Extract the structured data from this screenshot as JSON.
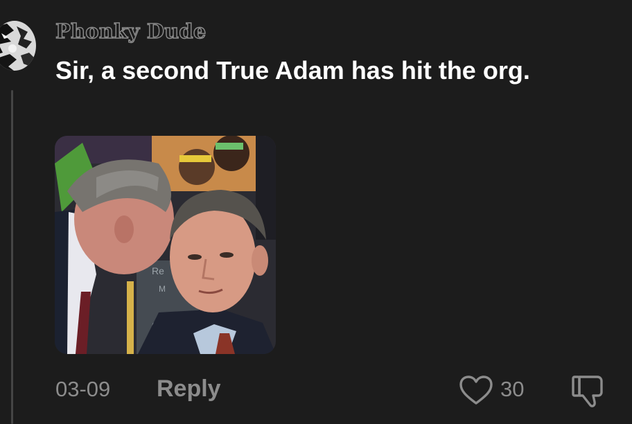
{
  "comment": {
    "author": "Phonky Dude",
    "text": "Sir, a second True Adam has hit the org.",
    "date": "03-09",
    "reply_label": "Reply",
    "like_count": "30",
    "icons": {
      "avatar": "avatar",
      "like": "heart-icon",
      "dislike": "thumbs-down-icon"
    }
  },
  "colors": {
    "background": "#1c1c1c",
    "text_primary": "#ffffff",
    "text_secondary": "#8c8c8c",
    "thread_line": "#454545"
  }
}
